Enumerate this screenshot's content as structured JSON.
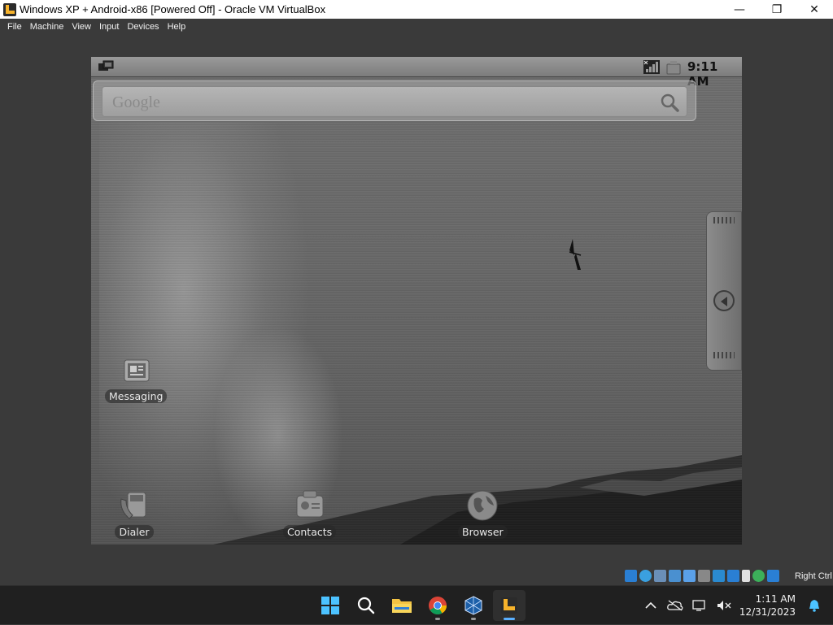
{
  "window": {
    "title": "Windows XP + Android-x86 [Powered Off] - Oracle VM VirtualBox",
    "minimize": "—",
    "maximize": "❐",
    "close": "✕"
  },
  "menu": [
    "File",
    "Machine",
    "View",
    "Input",
    "Devices",
    "Help"
  ],
  "android": {
    "status": {
      "time": "9:11 AM"
    },
    "search": {
      "logo": "Google"
    },
    "apps": [
      {
        "label": "Messaging",
        "icon": "messaging-icon"
      },
      {
        "label": "Dialer",
        "icon": "dialer-icon"
      },
      {
        "label": "Contacts",
        "icon": "contacts-icon"
      },
      {
        "label": "Browser",
        "icon": "browser-globe-icon"
      }
    ]
  },
  "vbox_status": {
    "host_key": "Right Ctrl"
  },
  "taskbar": {
    "apps": [
      "start-icon",
      "search-icon",
      "file-explorer-icon",
      "chrome-icon",
      "virtualbox-icon",
      "virtualbox-vm-icon"
    ],
    "clock_time": "1:11 AM",
    "clock_date": "12/31/2023"
  },
  "colors": {
    "taskbar_bg": "#202020",
    "accent_blue": "#5ab0ff",
    "vm_icon_orange": "#f7b32b"
  }
}
